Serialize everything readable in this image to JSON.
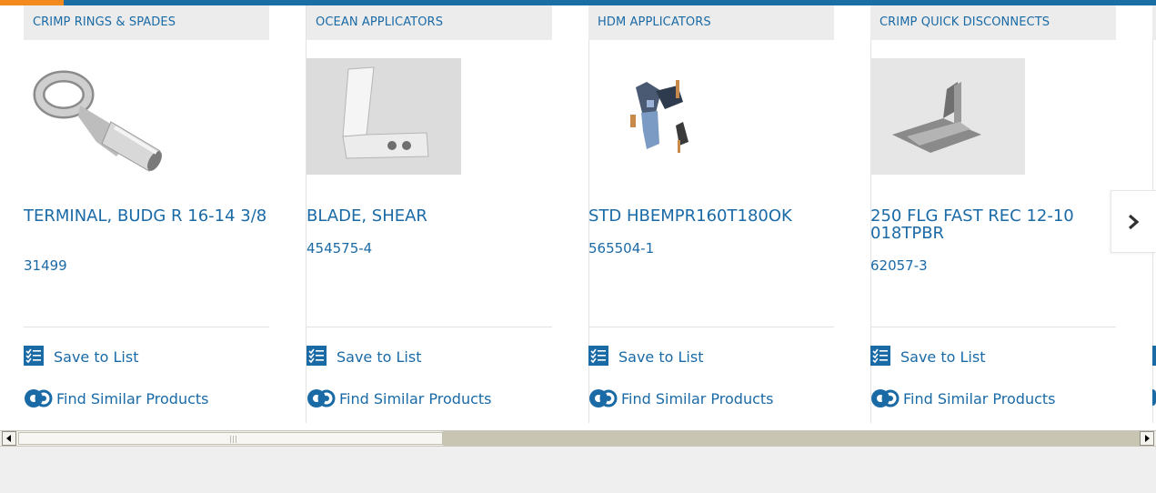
{
  "carousel": {
    "cards": [
      {
        "category": "CRIMP RINGS & SPADES",
        "title": "TERMINAL, BUDG R 16-14 3/8",
        "part_number": "31499",
        "save": "Save to List",
        "similar": "Find Similar Products"
      },
      {
        "category": "OCEAN APPLICATORS",
        "title": "BLADE, SHEAR",
        "part_number": "454575-4",
        "save": "Save to List",
        "similar": "Find Similar Products"
      },
      {
        "category": "HDM APPLICATORS",
        "title": "STD HBEMPR160T180OK",
        "part_number": "565504-1",
        "save": "Save to List",
        "similar": "Find Similar Products"
      },
      {
        "category": "CRIMP QUICK DISCONNECTS",
        "title": "250 FLG FAST REC 12-10 018TPBR",
        "part_number": "62057-3",
        "save": "Save to List",
        "similar": "Find Similar Products"
      }
    ],
    "icons": {
      "next": "chevron-right-icon",
      "save": "checklist-icon",
      "similar": "gears-icon"
    }
  },
  "colors": {
    "brand_blue": "#1a6aa6",
    "accent_orange": "#f28a1e",
    "header_bar": "#1b6ea4"
  }
}
